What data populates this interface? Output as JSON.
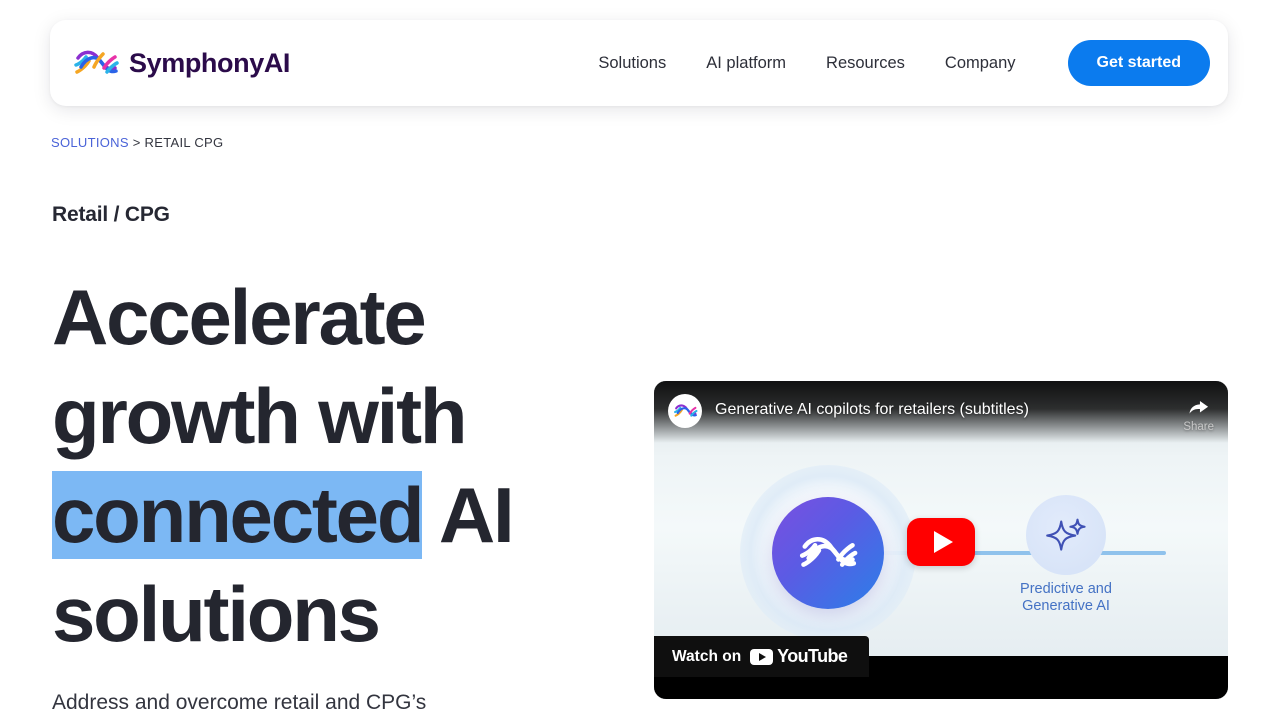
{
  "header": {
    "brand_name": "SymphonyAI",
    "brand_mark_icon": "symphonyai-wave-logo-icon",
    "nav": [
      {
        "label": "Solutions"
      },
      {
        "label": "AI platform"
      },
      {
        "label": "Resources"
      },
      {
        "label": "Company"
      }
    ],
    "cta_label": "Get started",
    "cta_color": "#0B7BEE"
  },
  "breadcrumb": {
    "parent": "SOLUTIONS",
    "separator": ">",
    "current": "RETAIL CPG",
    "link_color": "#4A63D8"
  },
  "hero": {
    "eyebrow": "Retail / CPG",
    "heading_before": "Accelerate growth with ",
    "heading_highlight": "connected",
    "heading_after": " AI solutions",
    "highlight_color": "#7CB8F4",
    "body": "Address and overcome retail and CPG’s"
  },
  "video": {
    "title": "Generative AI copilots for retailers (subtitles)",
    "avatar_icon": "symphonyai-channel-avatar-icon",
    "share_label": "Share",
    "share_icon": "share-arrow-icon",
    "play_icon": "youtube-play-icon",
    "watch_on_label": "Watch on",
    "youtube_wordmark": "YouTube",
    "youtube_red": "#FF0000",
    "thumbnail": {
      "node_logo_icon": "symphonyai-wave-logo-icon",
      "node_gradient_from": "#7B4FE0",
      "node_gradient_to": "#2B7FE8",
      "sparkle_icon": "sparkle-ai-icon",
      "node2_label": "Predictive and\nGenerative AI",
      "node2_label_line1": "Predictive and",
      "node2_label_line2": "Generative AI",
      "connector_color": "#8FC2EC"
    }
  }
}
